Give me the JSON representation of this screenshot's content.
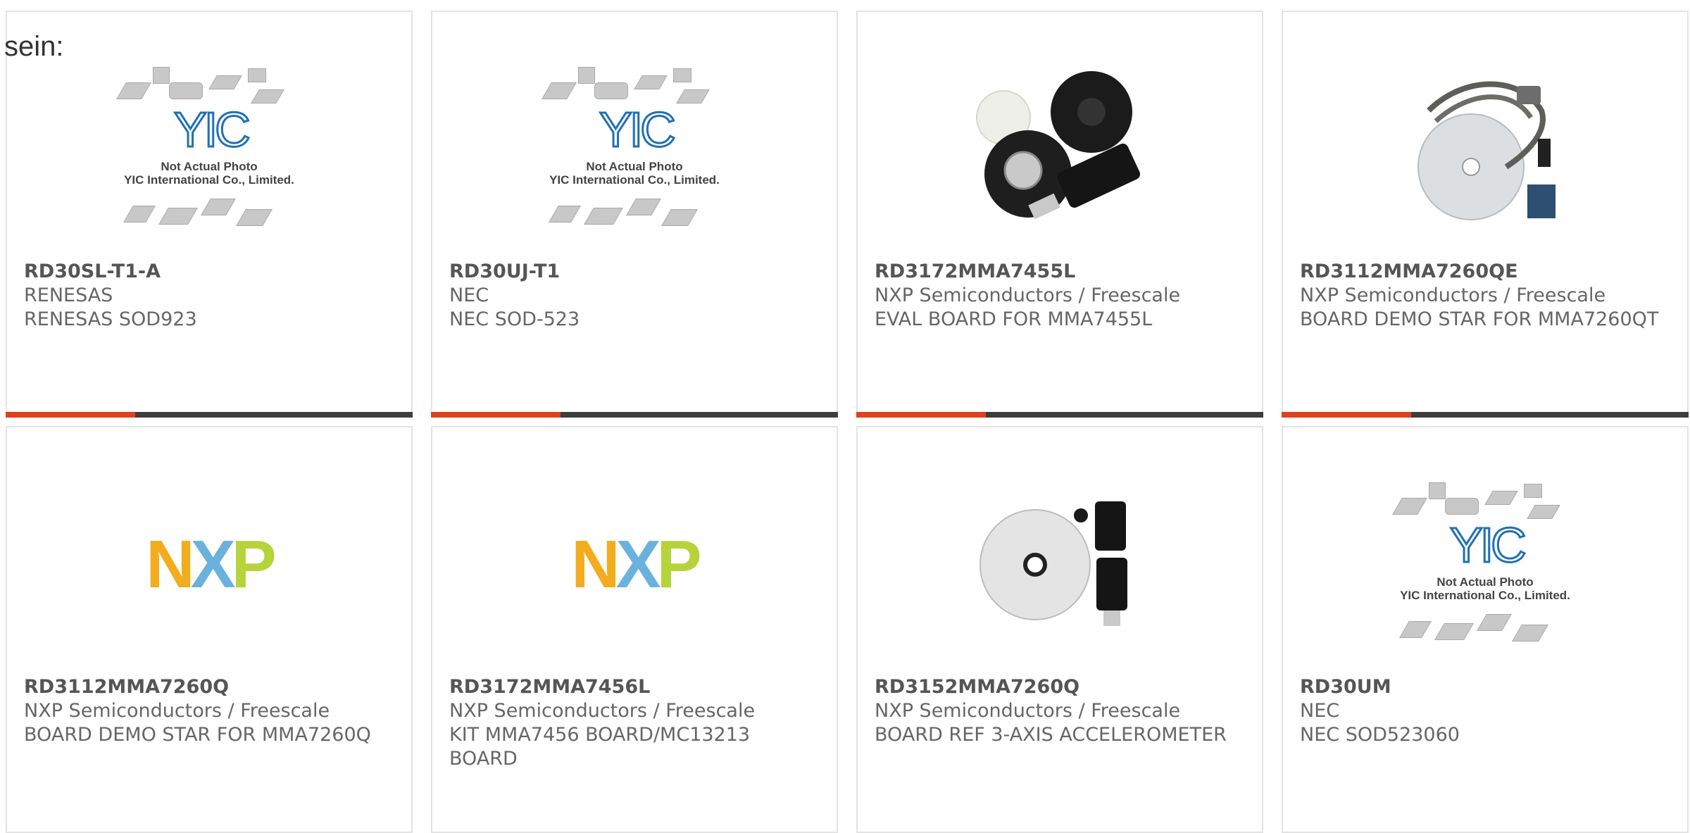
{
  "lead_text": "sein:",
  "image_caption": [
    "Not Actual Photo",
    "YIC International Co., Limited."
  ],
  "nxp_logo_letters": [
    "N",
    "X",
    "P"
  ],
  "colors": {
    "accent": "#e2401c",
    "bar": "#3d3d3d",
    "border": "#e3e3e3"
  },
  "products": [
    {
      "part": "RD30SL-T1-A",
      "maker": "RENESAS",
      "desc": "RENESAS SOD923",
      "image": "placeholder"
    },
    {
      "part": "RD30UJ-T1",
      "maker": "NEC",
      "desc": "NEC SOD-523",
      "image": "placeholder"
    },
    {
      "part": "RD3172MMA7455L",
      "maker": "NXP Semiconductors / Freescale",
      "desc": "EVAL BOARD FOR MMA7455L",
      "image": "board-photo"
    },
    {
      "part": "RD3112MMA7260QE",
      "maker": "NXP Semiconductors / Freescale",
      "desc": "BOARD DEMO STAR FOR MMA7260QT",
      "image": "cable-cd-photo"
    },
    {
      "part": "RD3112MMA7260Q",
      "maker": "NXP Semiconductors / Freescale",
      "desc": "BOARD DEMO STAR FOR MMA7260Q",
      "image": "nxp-logo"
    },
    {
      "part": "RD3172MMA7456L",
      "maker": "NXP Semiconductors / Freescale",
      "desc": "KIT MMA7456 BOARD/MC13213 BOARD",
      "image": "nxp-logo"
    },
    {
      "part": "RD3152MMA7260Q",
      "maker": "NXP Semiconductors / Freescale",
      "desc": "BOARD REF 3-AXIS ACCELEROMETER",
      "image": "cd-kit-photo"
    },
    {
      "part": "RD30UM",
      "maker": "NEC",
      "desc": "NEC SOD523060",
      "image": "placeholder"
    }
  ]
}
